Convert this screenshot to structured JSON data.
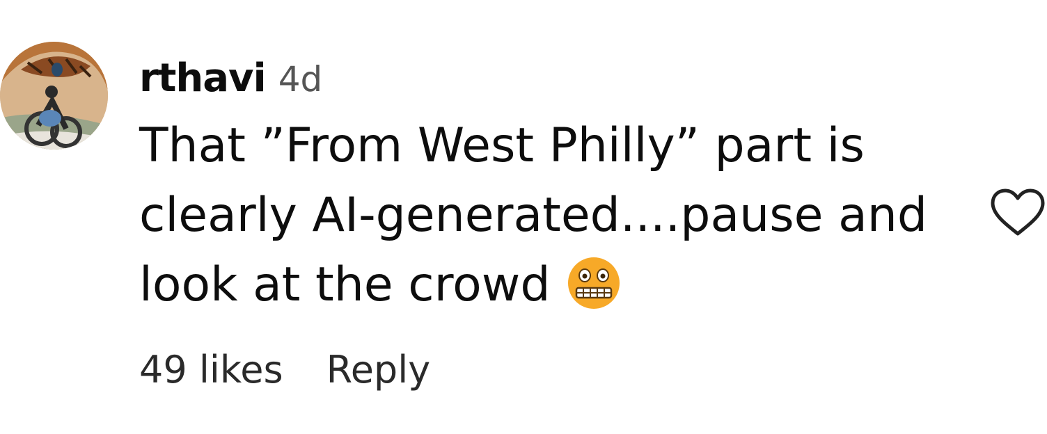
{
  "comment": {
    "username": "rthavi",
    "timestamp": "4d",
    "lines": [
      "That ”From West Philly” part is",
      "clearly AI-generated....pause and",
      "look at the crowd"
    ],
    "emoji": "grimacing-face-icon",
    "likes_label": "49 likes",
    "reply_label": "Reply",
    "like_icon": "heart-outline-icon"
  },
  "colors": {
    "text": "#0d0d0d",
    "secondary_text": "#555555",
    "heart_stroke": "#222222",
    "emoji_face": "#f7a928"
  }
}
